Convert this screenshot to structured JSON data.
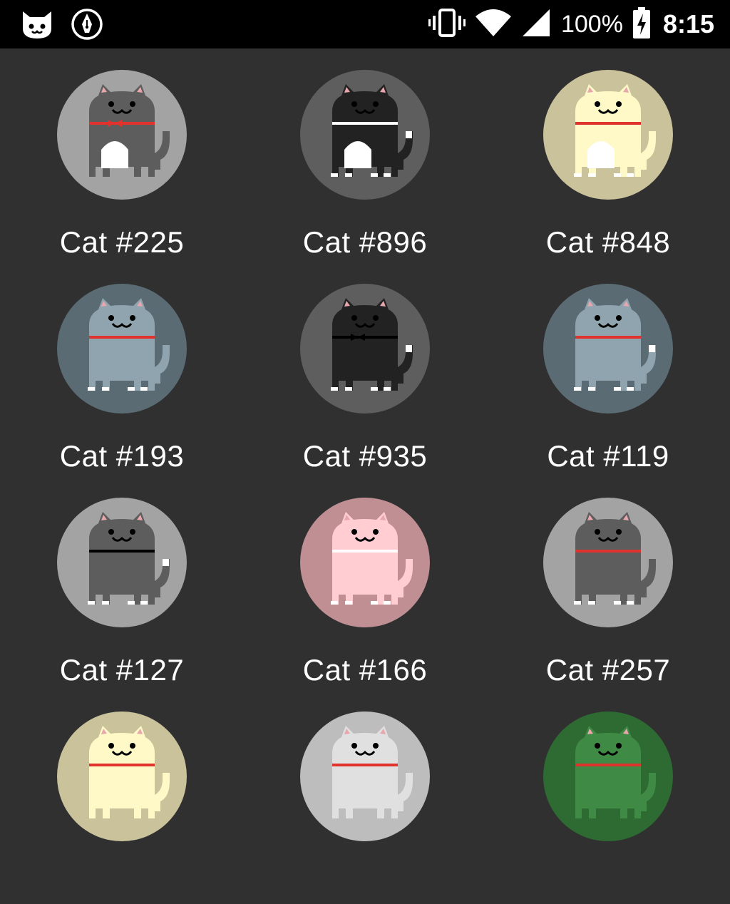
{
  "status_bar": {
    "app_icons": [
      "cat-face-icon",
      "pen-nib-icon"
    ],
    "system_icons": [
      "vibrate-icon",
      "wifi-icon",
      "cell-signal-icon"
    ],
    "battery_percent": "100%",
    "battery_icon": "battery-charging-icon",
    "time": "8:15"
  },
  "cats": [
    {
      "label": "Cat #225",
      "bg": "#a3a3a3",
      "body": "#5d5d5d",
      "collar": "#e0332d",
      "bow": true,
      "belly": true,
      "tailTip": false,
      "toes": false
    },
    {
      "label": "Cat #896",
      "bg": "#5e5e5e",
      "body": "#222222",
      "collar": "#ffffff",
      "bow": false,
      "belly": true,
      "tailTip": true,
      "toes": true
    },
    {
      "label": "Cat #848",
      "bg": "#c9c29b",
      "body": "#fef9c7",
      "collar": "#e0332d",
      "bow": false,
      "belly": true,
      "tailTip": false,
      "toes": true
    },
    {
      "label": "Cat #193",
      "bg": "#5a6b74",
      "body": "#8fa4ae",
      "collar": "#e0332d",
      "bow": false,
      "belly": false,
      "tailTip": false,
      "toes": true
    },
    {
      "label": "Cat #935",
      "bg": "#5e5e5e",
      "body": "#222222",
      "collar": "#000000",
      "bow": true,
      "belly": false,
      "tailTip": true,
      "toes": true
    },
    {
      "label": "Cat #119",
      "bg": "#5a6b74",
      "body": "#8fa4ae",
      "collar": "#e0332d",
      "bow": false,
      "belly": false,
      "tailTip": true,
      "toes": true
    },
    {
      "label": "Cat #127",
      "bg": "#a3a3a3",
      "body": "#5d5d5d",
      "collar": "#000000",
      "bow": false,
      "belly": false,
      "tailTip": true,
      "toes": true
    },
    {
      "label": "Cat #166",
      "bg": "#c08f93",
      "body": "#ffcdd2",
      "collar": "#ffffff",
      "bow": false,
      "belly": false,
      "tailTip": false,
      "toes": true
    },
    {
      "label": "Cat #257",
      "bg": "#a3a3a3",
      "body": "#5d5d5d",
      "collar": "#e0332d",
      "bow": false,
      "belly": false,
      "tailTip": false,
      "toes": true
    },
    {
      "label": "",
      "bg": "#c9c29b",
      "body": "#fef9c7",
      "collar": "#e0332d",
      "bow": false,
      "belly": false,
      "tailTip": false,
      "toes": false
    },
    {
      "label": "",
      "bg": "#bdbdbd",
      "body": "#e0e0e0",
      "collar": "#e0332d",
      "bow": false,
      "belly": false,
      "tailTip": false,
      "toes": false
    },
    {
      "label": "",
      "bg": "#2e6b33",
      "body": "#3f8b45",
      "collar": "#e0332d",
      "bow": false,
      "belly": false,
      "tailTip": false,
      "toes": false
    }
  ]
}
